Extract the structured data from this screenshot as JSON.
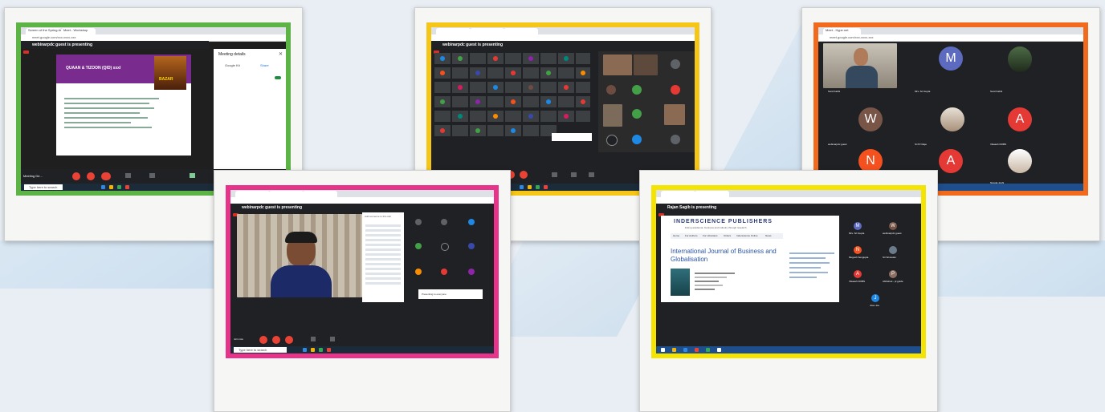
{
  "screens": {
    "s1": {
      "tab1": "Screen of the Spring-time [h...",
      "tab2": "Meet - Workshop",
      "url": "meet.google.com/xxx-xxxx-xxx",
      "presenting": "webinarpdc guest is presenting",
      "slide_title": "QUAAN & TIZOON (QID) xxxl",
      "slide_image_label": "BAZAR",
      "panel_title": "Meeting details",
      "panel_item1": "Google Kit",
      "panel_item2": "Share",
      "meeting_label": "Meeting De...",
      "search_label": "Type here to search",
      "border_color": "#5db346"
    },
    "s2": {
      "presenting": "webinarpdc guest is presenting",
      "caption": "Report former top bill for meeting",
      "search_label": "Type here to search",
      "border_color": "#f5c518"
    },
    "s3": {
      "tab": "Meet - Hype.net",
      "url": "meet.google.com/xxx-xxxx-xxx",
      "tiles": [
        {
          "letter": "M",
          "color": "#5c6bc0",
          "name": "Mrs. Sri Gupta"
        },
        {
          "letter": "W",
          "color": "#795548",
          "name": "webinarpdc guest"
        },
        {
          "letter": "A",
          "color": "#e53935",
          "name": "Vikaash DOBS"
        },
        {
          "letter": "N",
          "color": "#f4511e",
          "name": "Mugesh Sengupta"
        },
        {
          "letter": "A",
          "color": "#e53935",
          "name": "Smitha Mishra"
        },
        {
          "letter": "",
          "color": "#6b7b8a",
          "name": "Niveda Joshi"
        }
      ],
      "self_name": "Sunil Kabbi",
      "guest_name": "Sunil Kabbi",
      "border_color": "#f26b1d"
    },
    "s4": {
      "presenting": "webinarpdc guest is presenting",
      "people_label": "Add someone to this call",
      "notice": "Presenting to everyone",
      "meeting_label": "Join now",
      "search_label": "Type here to search",
      "border_color": "#e8338a"
    },
    "s5": {
      "presenting": "Rajan Sagib is presenting",
      "publisher": "INDERSCIENCE PUBLISHERS",
      "publisher_tagline": "linking academia, business and industry through research",
      "nav": [
        "Home",
        "For Authors",
        "For Librarians",
        "Orders",
        "Inderscience Online",
        "News"
      ],
      "journal_title": "International Journal of Business and Globalisation",
      "tiles": [
        {
          "letter": "M",
          "color": "#5c6bc0",
          "name": "Mrs. Sri Gupta"
        },
        {
          "letter": "W",
          "color": "#795548",
          "name": "webinarpdc guest"
        },
        {
          "letter": "N",
          "color": "#f4511e",
          "name": "Mugesh Sengupta"
        },
        {
          "letter": "",
          "color": "#6b7b8a",
          "name": "Sri Srivastav"
        },
        {
          "letter": "A",
          "color": "#e53935",
          "name": "Vikaash DOBS"
        },
        {
          "letter": "P",
          "color": "#8d6e63",
          "name": "Abhishek - pl guide"
        },
        {
          "letter": "J",
          "color": "#1e88e5",
          "name": "Jose Joe"
        }
      ],
      "border_color": "#f5e400"
    }
  }
}
